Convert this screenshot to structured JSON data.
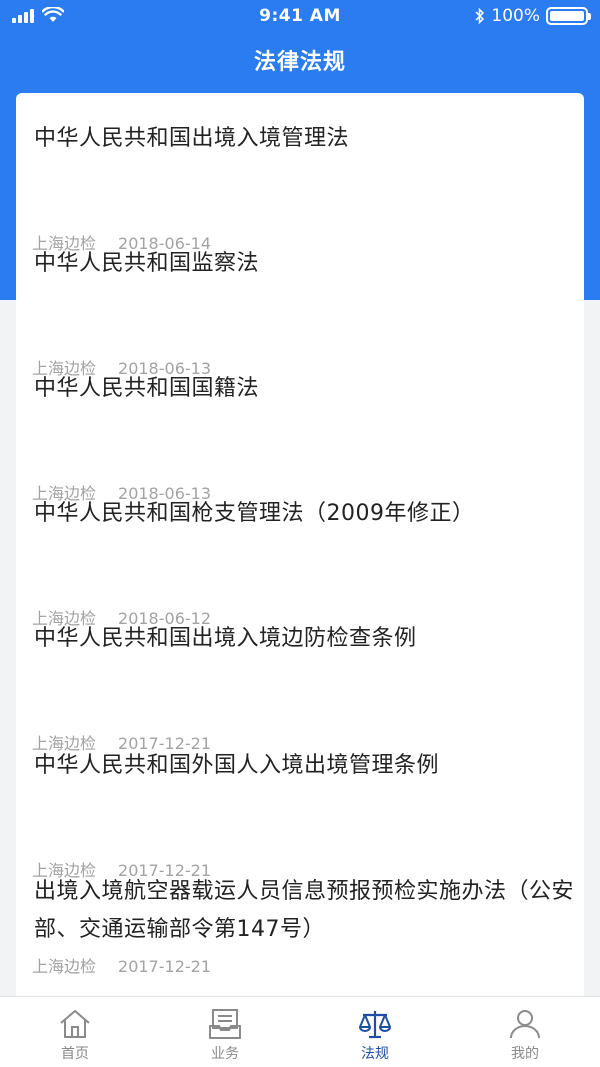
{
  "status_bar": {
    "time": "9:41 AM",
    "battery": "100%"
  },
  "nav": {
    "title": "法律法规"
  },
  "laws": [
    {
      "title": "中华人民共和国出境入境管理法",
      "source": "上海边检",
      "date": "2018-06-14"
    },
    {
      "title": "中华人民共和国监察法",
      "source": "上海边检",
      "date": "2018-06-13"
    },
    {
      "title": "中华人民共和国国籍法",
      "source": "上海边检",
      "date": "2018-06-13"
    },
    {
      "title": "中华人民共和国枪支管理法（2009年修正）",
      "source": "上海边检",
      "date": "2018-06-12"
    },
    {
      "title": "中华人民共和国出境入境边防检查条例",
      "source": "上海边检",
      "date": "2017-12-21"
    },
    {
      "title": "中华人民共和国外国人入境出境管理条例",
      "source": "上海边检",
      "date": "2017-12-21"
    },
    {
      "title": "出境入境航空器载运人员信息预报预检实施办法（公安部、交通运输部令第147号）",
      "source": "上海边检",
      "date": "2017-12-21"
    }
  ],
  "tabbar": {
    "tabs": [
      {
        "label": "首页",
        "icon": "home-icon"
      },
      {
        "label": "业务",
        "icon": "inbox-icon"
      },
      {
        "label": "法规",
        "icon": "scale-icon"
      },
      {
        "label": "我的",
        "icon": "user-icon"
      }
    ],
    "active_color": "#1f4fa3",
    "inactive_color": "#8a8a8a"
  },
  "colors": {
    "header": "#2a7cf0",
    "background": "#f2f3f5"
  }
}
